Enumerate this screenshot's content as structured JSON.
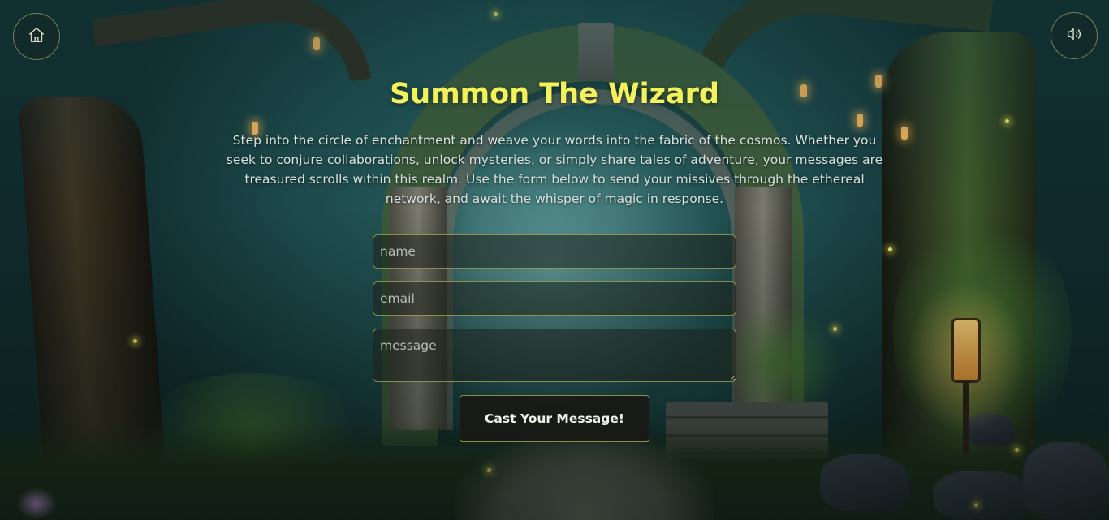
{
  "header": {
    "home_icon": "home-icon",
    "sound_icon": "volume-icon"
  },
  "main": {
    "title": "Summon The Wizard",
    "intro": "Step into the circle of enchantment and weave your words into the fabric of the cosmos. Whether you seek to conjure collaborations, unlock mysteries, or simply share tales of adventure, your messages are treasured scrolls within this realm. Use the form below to send your missives through the ethereal network, and await the whisper of magic in response."
  },
  "form": {
    "name_placeholder": "name",
    "name_value": "",
    "email_placeholder": "email",
    "email_value": "",
    "message_placeholder": "message",
    "message_value": "",
    "submit_label": "Cast Your Message!"
  },
  "colors": {
    "title": "#f4f25a",
    "field_border": "#bebe5a",
    "button_bg": "#181814"
  }
}
